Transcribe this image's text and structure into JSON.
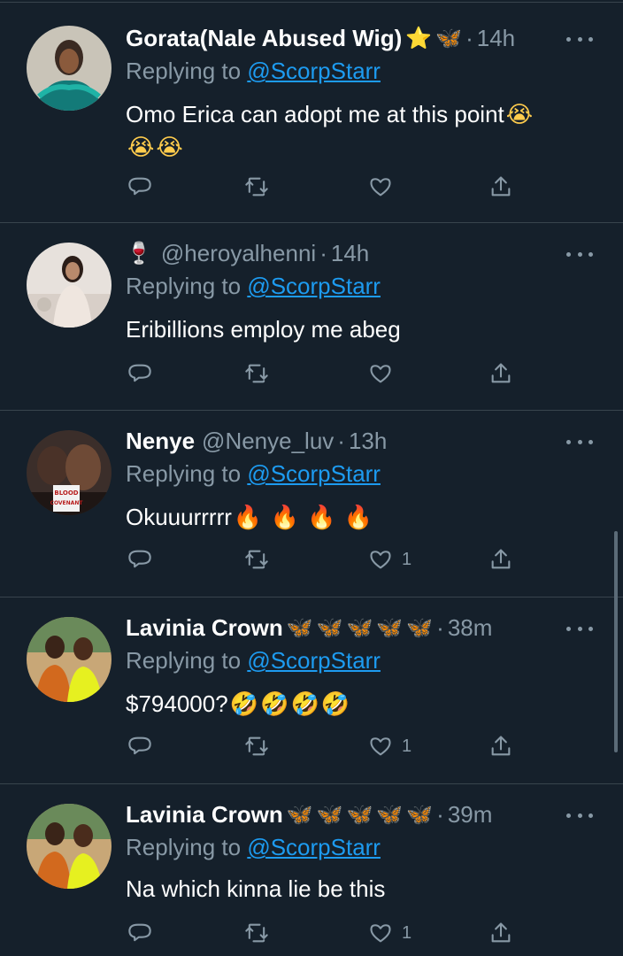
{
  "tweets": [
    {
      "name": "Gorata(Nale Abused Wig)",
      "name_emojis": [
        "⭐",
        "🦋"
      ],
      "handle": "",
      "time": "14h",
      "replying_prefix": "Replying to ",
      "replying_handle": "@ScorpStarr",
      "text": "Omo Erica can adopt me at this point",
      "text_emojis": [
        "😭",
        "😭",
        "😭"
      ],
      "likes": ""
    },
    {
      "name": "",
      "name_emojis": [
        "🍷"
      ],
      "handle": "@heroyalhenni",
      "time": "14h",
      "replying_prefix": "Replying to ",
      "replying_handle": "@ScorpStarr",
      "text": "Eribillions employ me abeg",
      "text_emojis": [],
      "likes": ""
    },
    {
      "name": "Nenye",
      "name_emojis": [],
      "handle": "@Nenye_luv",
      "time": "13h",
      "replying_prefix": "Replying to ",
      "replying_handle": "@ScorpStarr",
      "text": "Okuuurrrrr",
      "text_emojis": [
        "🔥",
        "🔥",
        "🔥",
        "🔥"
      ],
      "likes": "1",
      "avatar_badge": "THE BLOOD COVENANT"
    },
    {
      "name": "Lavinia Crown",
      "name_emojis": [
        "🦋",
        "🦋",
        "🦋",
        "🦋",
        "🦋"
      ],
      "handle": "",
      "time": "38m",
      "replying_prefix": "Replying to ",
      "replying_handle": "@ScorpStarr",
      "text": "$794000?",
      "text_emojis": [
        "🤣",
        "🤣",
        "🤣",
        "🤣"
      ],
      "likes": "1"
    },
    {
      "name": "Lavinia Crown",
      "name_emojis": [
        "🦋",
        "🦋",
        "🦋",
        "🦋",
        "🦋"
      ],
      "handle": "",
      "time": "39m",
      "replying_prefix": "Replying to ",
      "replying_handle": "@ScorpStarr",
      "text": "Na which kinna lie be this",
      "text_emojis": [],
      "likes": "1"
    }
  ],
  "icons": {
    "reply": "reply-icon",
    "retweet": "retweet-icon",
    "like": "heart-icon",
    "share": "share-icon",
    "more": "more-icon"
  },
  "colors": {
    "background": "#15202b",
    "secondary_text": "#8899a6",
    "link": "#1d9bf0",
    "divider": "#38444d"
  }
}
